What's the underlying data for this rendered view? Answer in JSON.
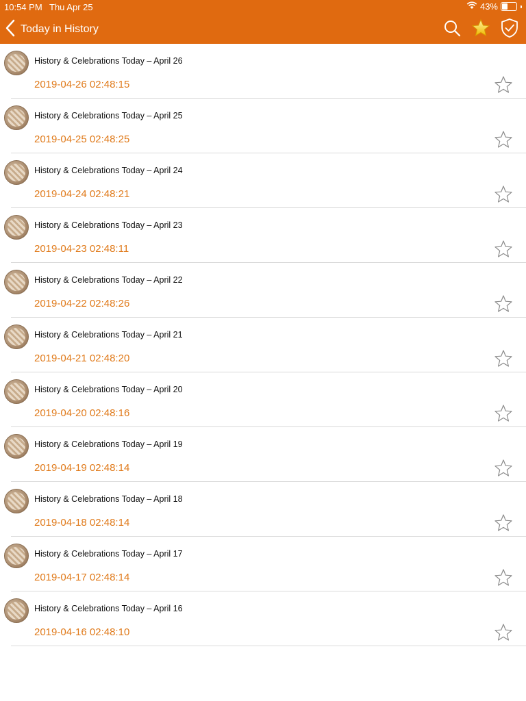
{
  "status_bar": {
    "time": "10:54 PM",
    "date": "Thu Apr 25",
    "battery": "43%",
    "battery_level": 0.43,
    "wifi_icon": "wifi-icon"
  },
  "header": {
    "title": "Today in History",
    "background_color": "#e06a10",
    "icons": [
      "chevron-left-icon",
      "search-icon",
      "star-filled-icon",
      "shield-check-icon"
    ]
  },
  "accent_color": "#e07a1a",
  "items": [
    {
      "title": "History & Celebrations Today – April 26",
      "date": "2019-04-26 02:48:15",
      "favorited": false
    },
    {
      "title": "History & Celebrations Today – April 25",
      "date": "2019-04-25 02:48:25",
      "favorited": false
    },
    {
      "title": "History & Celebrations Today – April 24",
      "date": "2019-04-24 02:48:21",
      "favorited": false
    },
    {
      "title": "History & Celebrations Today – April 23",
      "date": "2019-04-23 02:48:11",
      "favorited": false
    },
    {
      "title": "History & Celebrations Today – April 22",
      "date": "2019-04-22 02:48:26",
      "favorited": false
    },
    {
      "title": "History & Celebrations Today – April 21",
      "date": "2019-04-21 02:48:20",
      "favorited": false
    },
    {
      "title": "History & Celebrations Today – April 20",
      "date": "2019-04-20 02:48:16",
      "favorited": false
    },
    {
      "title": "History & Celebrations Today – April 19",
      "date": "2019-04-19 02:48:14",
      "favorited": false
    },
    {
      "title": "History & Celebrations Today – April 18",
      "date": "2019-04-18 02:48:14",
      "favorited": false
    },
    {
      "title": "History & Celebrations Today – April 17",
      "date": "2019-04-17 02:48:14",
      "favorited": false
    },
    {
      "title": "History & Celebrations Today – April 16",
      "date": "2019-04-16 02:48:10",
      "favorited": false
    }
  ]
}
